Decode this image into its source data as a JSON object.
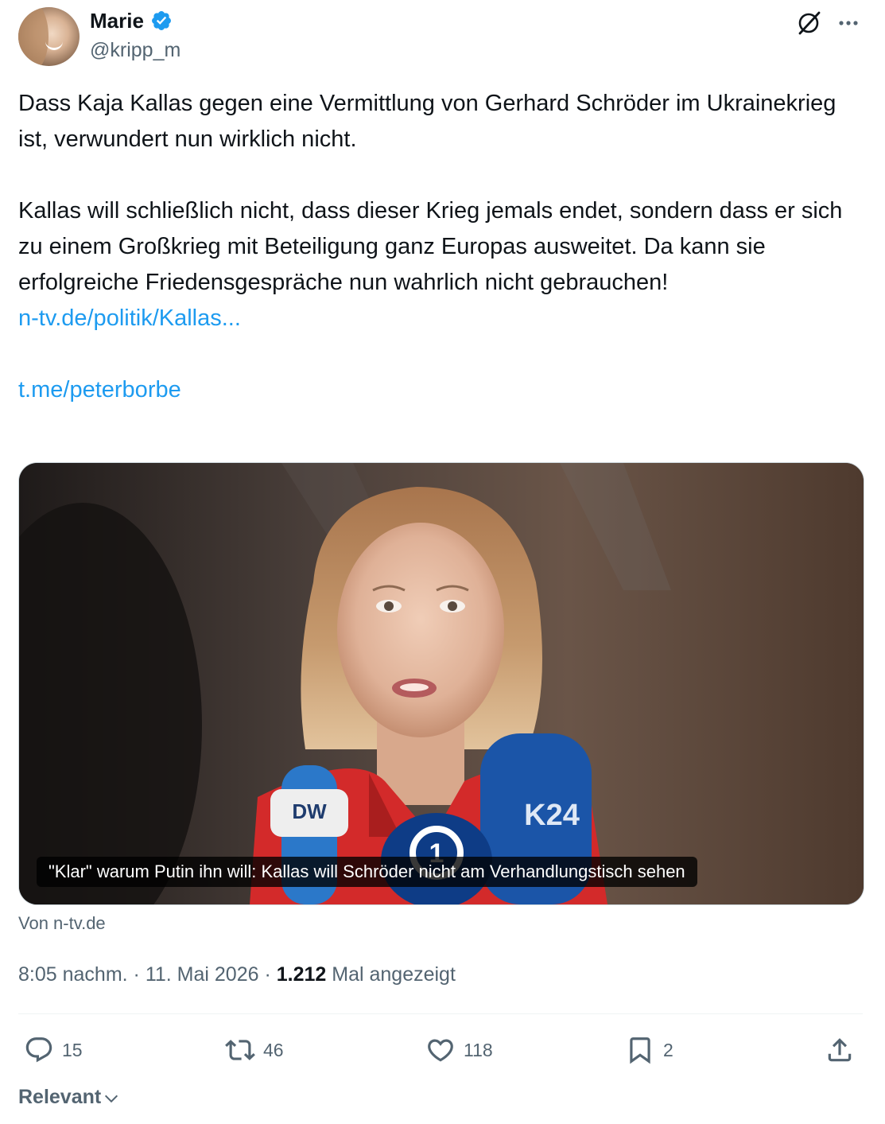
{
  "author": {
    "display_name": "Marie",
    "handle": "@kripp_m",
    "verified": true
  },
  "tweet": {
    "paragraph1": "Dass Kaja Kallas gegen eine Vermittlung von Gerhard Schröder im Ukrainekrieg ist, verwundert nun wirklich nicht.",
    "paragraph2": "Kallas will schließlich nicht, dass dieser Krieg jemals endet, sondern dass er sich zu einem Großkrieg mit Beteiligung ganz Europas ausweitet. Da kann sie erfolgreiche Friedensgespräche nun wahrlich nicht gebrauchen!",
    "link1": "n-tv.de/politik/Kallas...",
    "link2": "t.me/peterborbe"
  },
  "card": {
    "caption": "\"Klar\" warum Putin ihn will: Kallas will Schröder nicht am Verhandlungstisch sehen",
    "source": "Von n-tv.de"
  },
  "meta": {
    "time": "8:05 nachm.",
    "separator": " · ",
    "date": "11. Mai 2026",
    "views": "1.212",
    "views_label": "Mal angezeigt"
  },
  "actions": {
    "replies": "15",
    "reposts": "46",
    "likes": "118",
    "bookmarks": "2"
  },
  "sort_label": "Relevant",
  "colors": {
    "link": "#1d9bf0",
    "secondary_text": "#536471",
    "verified_badge": "#1d9bf0"
  },
  "icons": [
    "verified-badge-icon",
    "grok-icon",
    "more-icon",
    "reply-icon",
    "repost-icon",
    "like-icon",
    "bookmark-icon",
    "share-icon",
    "chevron-down-icon"
  ]
}
